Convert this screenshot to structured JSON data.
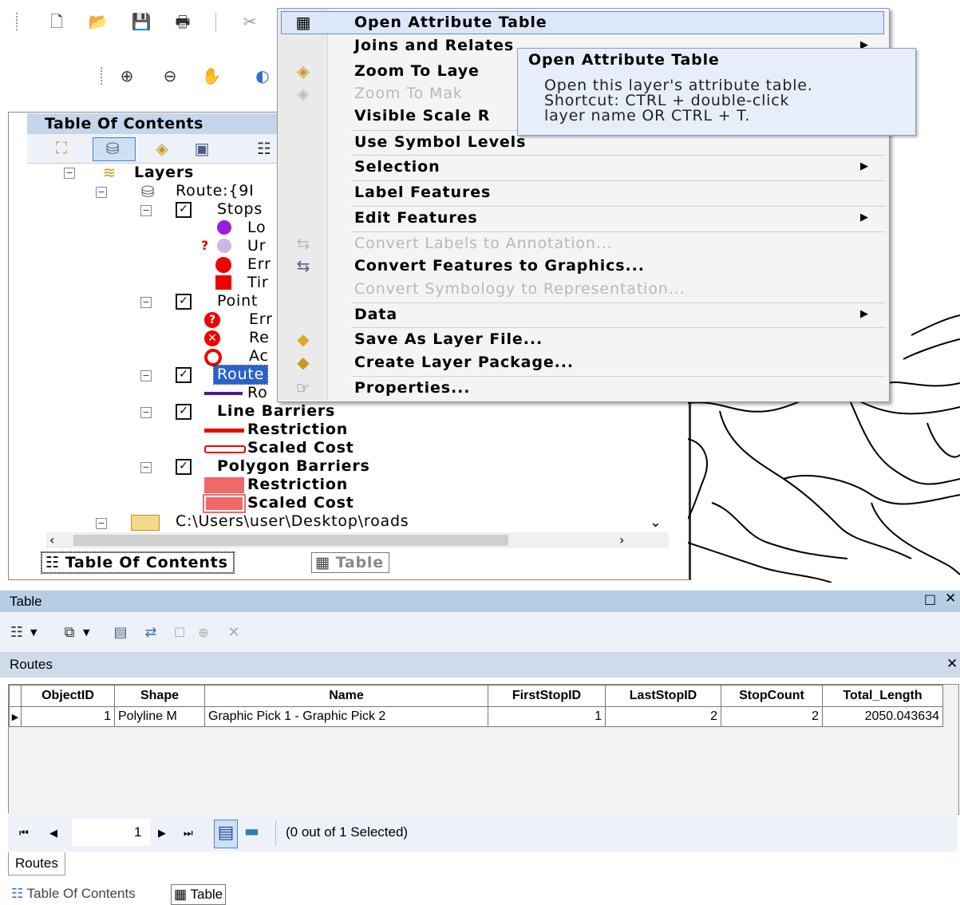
{
  "toc": {
    "title": "Table Of Contents",
    "layers_label": "Layers",
    "route_layer": "Route:{9I",
    "stops_group": "Stops",
    "stops_items": [
      "Lo",
      "Ur",
      "Err",
      "Tir"
    ],
    "point_group": "Point",
    "point_items": [
      "Err",
      "Re",
      "Ac"
    ],
    "routes_group": "Route",
    "routes_items": [
      "Ro"
    ],
    "line_barriers_group": "Line Barriers",
    "line_barriers_items": [
      "Restriction",
      "Scaled Cost"
    ],
    "polygon_barriers_group": "Polygon Barriers",
    "polygon_barriers_items": [
      "Restriction",
      "Scaled Cost"
    ],
    "folder_path": "C:\\Users\\user\\Desktop\\roads",
    "tab_toc": "Table Of Contents",
    "tab_table": "Table"
  },
  "menu": {
    "items": [
      {
        "label": "Open Attribute Table",
        "disabled": false
      },
      {
        "label": "Joins and Relates",
        "disabled": false
      },
      {
        "label": "Zoom To Laye",
        "disabled": false
      },
      {
        "label": "Zoom To Mak",
        "disabled": true
      },
      {
        "label": "Visible Scale R",
        "disabled": false
      },
      {
        "label": "Use Symbol Levels",
        "disabled": false
      },
      {
        "label": "Selection",
        "disabled": false
      },
      {
        "label": "Label Features",
        "disabled": false
      },
      {
        "label": "Edit Features",
        "disabled": false
      },
      {
        "label": "Convert Labels to Annotation...",
        "disabled": true
      },
      {
        "label": "Convert Features to Graphics...",
        "disabled": false
      },
      {
        "label": "Convert Symbology to Representation...",
        "disabled": true
      },
      {
        "label": "Data",
        "disabled": false
      },
      {
        "label": "Save As Layer File...",
        "disabled": false
      },
      {
        "label": "Create Layer Package...",
        "disabled": false
      },
      {
        "label": "Properties...",
        "disabled": false
      }
    ]
  },
  "tooltip": {
    "title": "Open Attribute Table",
    "line1": "Open this layer's attribute table.",
    "line2": "Shortcut: CTRL + double-click",
    "line3": "layer name OR CTRL + T."
  },
  "table_window": {
    "title": "Table",
    "sub_title": "Routes",
    "columns": [
      "ObjectID",
      "Shape",
      "Name",
      "FirstStopID",
      "LastStopID",
      "StopCount",
      "Total_Length"
    ],
    "rows": [
      [
        "1",
        "Polyline M",
        "Graphic Pick 1 - Graphic Pick 2",
        "1",
        "2",
        "2",
        "2050.043634"
      ]
    ],
    "record_value": "1",
    "selection_status": "(0 out of 1 Selected)",
    "bottom_tab": "Routes",
    "dock_tab_toc": "Table Of Contents",
    "dock_tab_table": "Table"
  }
}
